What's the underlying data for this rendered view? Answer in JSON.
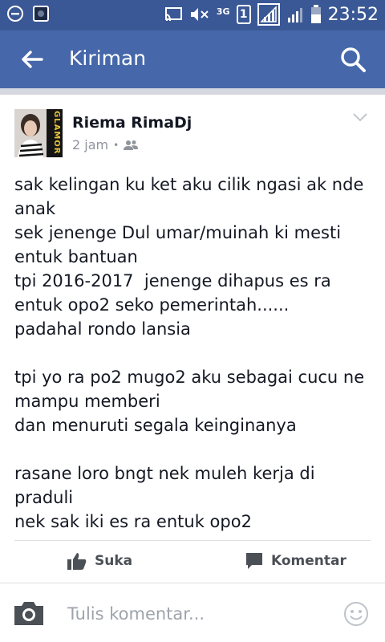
{
  "status_bar": {
    "network_label": "3G",
    "sim_label": "1",
    "time": "23:52"
  },
  "app_bar": {
    "title": "Kiriman"
  },
  "post": {
    "author": "Riema RimaDj",
    "time": "2 jam",
    "separator": "•",
    "avatar_text": "GLAMOR",
    "body": "sak kelingan ku ket aku cilik ngasi ak nde\nanak\nsek jenenge Dul umar/muinah ki mesti\nentuk bantuan\ntpi 2016-2017  jenenge dihapus es ra\nentuk opo2 seko pemerintah......\npadahal rondo lansia\n\ntpi yo ra po2 mugo2 aku sebagai cucu ne\nmampu memberi\ndan menuruti segala keinginanya\n\nrasane loro bngt nek muleh kerja di\npraduli\nnek sak iki es ra entuk opo2"
  },
  "actions": {
    "like_label": "Suka",
    "comment_label": "Komentar"
  },
  "composer": {
    "placeholder": "Tulis komentar..."
  },
  "colors": {
    "status_bar": "#3a5895",
    "app_bar": "#4668aa",
    "text": "#141823",
    "muted": "#90949c"
  }
}
